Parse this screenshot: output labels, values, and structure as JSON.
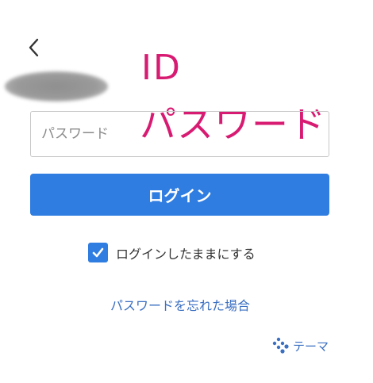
{
  "back": {
    "icon": "chevron-left-icon"
  },
  "annotations": {
    "id_label": "ID",
    "password_label": "パスワード"
  },
  "password_field": {
    "placeholder": "パスワード",
    "value": ""
  },
  "login_button": {
    "label": "ログイン"
  },
  "remember_me": {
    "label": "ログインしたままにする",
    "checked": true
  },
  "forgot_password": {
    "label": "パスワードを忘れた場合"
  },
  "theme": {
    "label": "テーマ",
    "icon": "palette-dots-icon"
  },
  "colors": {
    "accent": "#2f7de1",
    "link": "#3a6fc1",
    "annotation": "#d81b72"
  }
}
